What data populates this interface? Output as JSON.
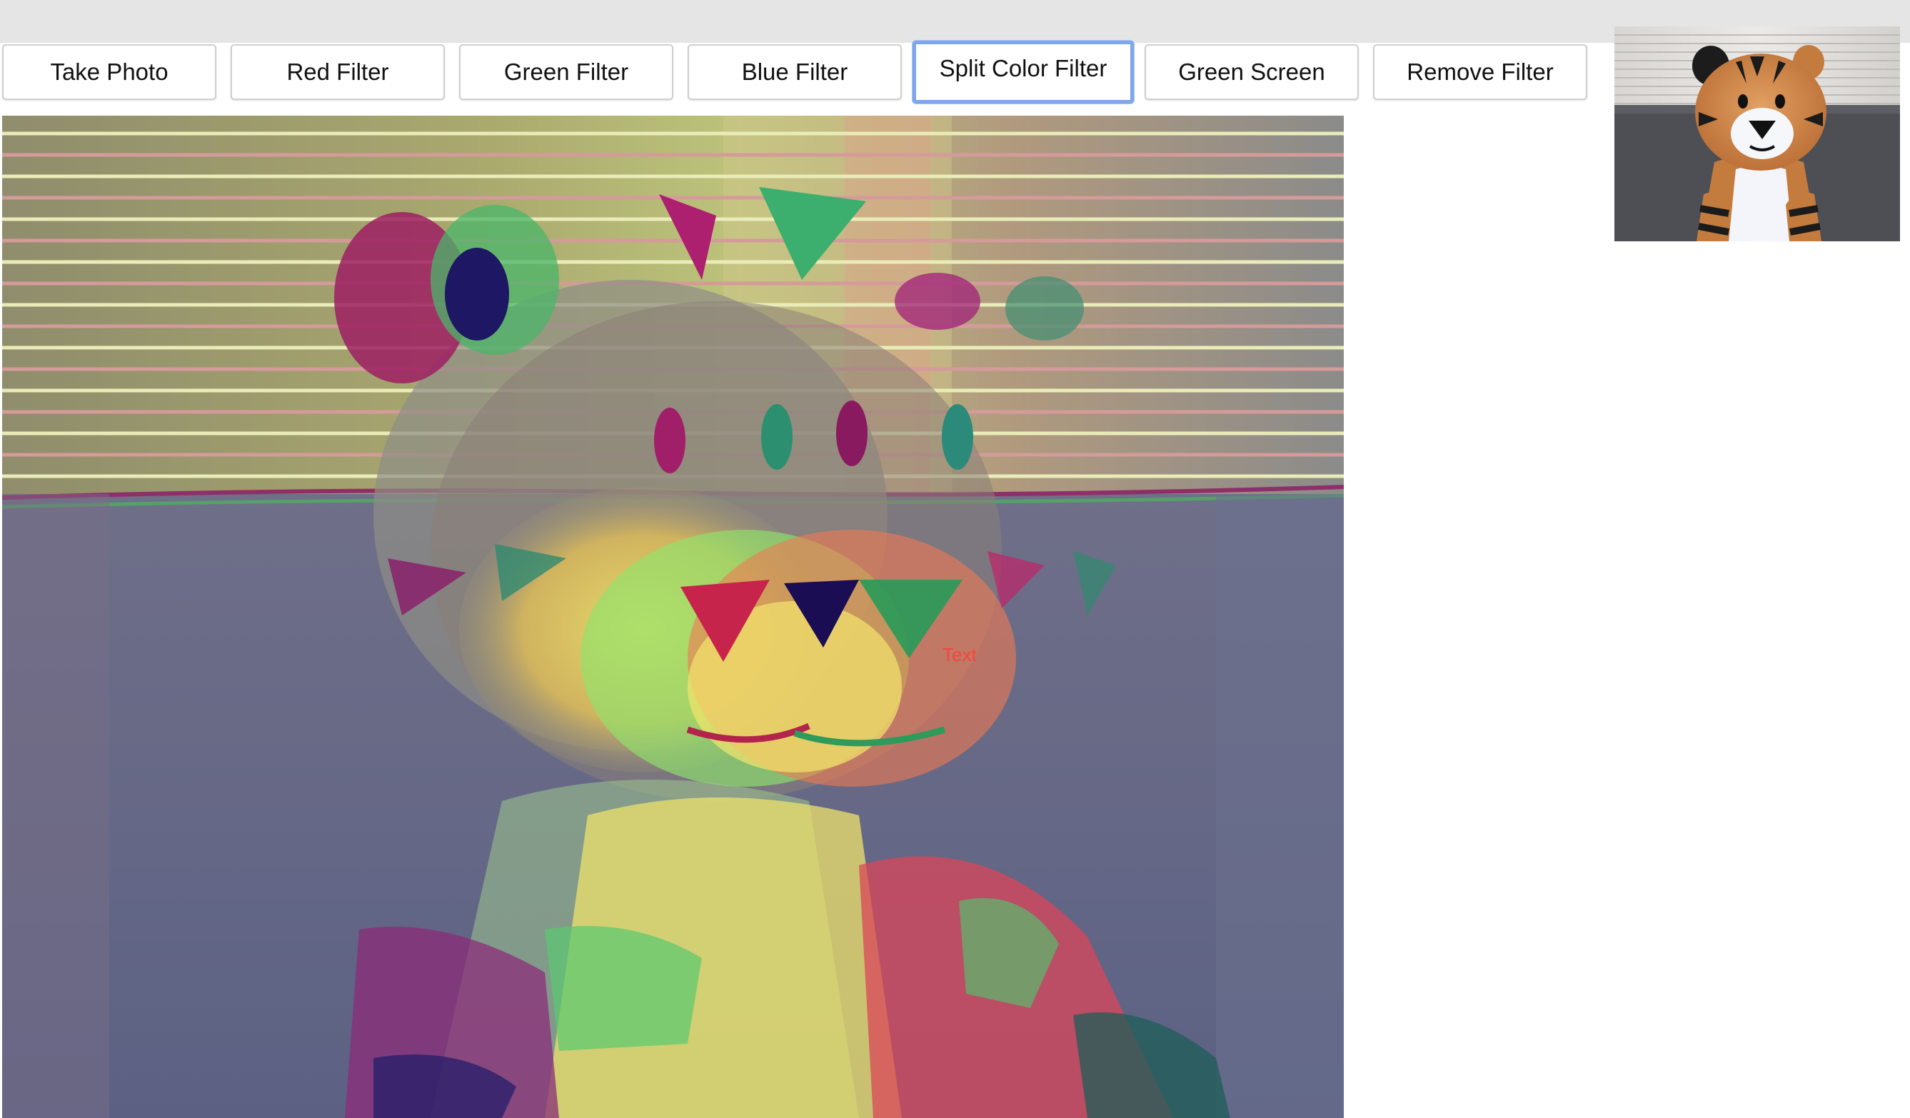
{
  "toolbar": {
    "buttons": [
      {
        "label": "Take Photo"
      },
      {
        "label": "Red Filter"
      },
      {
        "label": "Green Filter"
      },
      {
        "label": "Blue Filter"
      },
      {
        "label": "Split Color Filter",
        "active": true
      },
      {
        "label": "Green Screen"
      },
      {
        "label": "Remove Filter"
      }
    ]
  },
  "canvas": {
    "overlay_text": "Text",
    "overlay_text_color": "#ff3b3b"
  },
  "colors": {
    "topbar": "#e5e5e5",
    "button_border": "#cfcfcf",
    "active_focus_ring": "#7ea6ec"
  }
}
